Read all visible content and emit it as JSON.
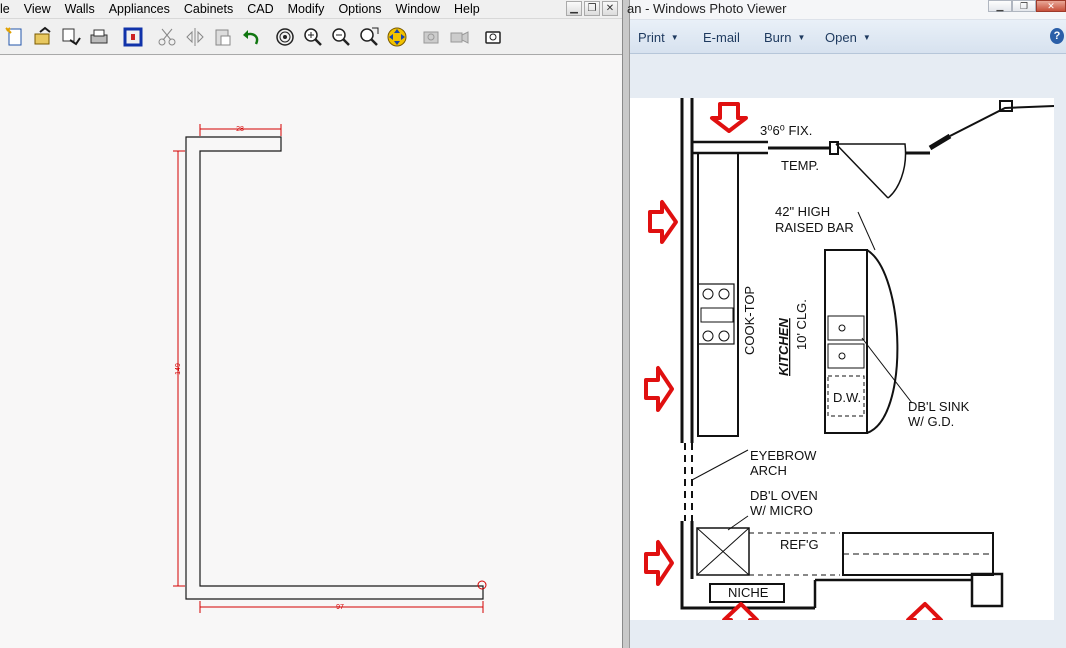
{
  "left_app": {
    "menu": [
      "le",
      "View",
      "Walls",
      "Appliances",
      "Cabinets",
      "CAD",
      "Modify",
      "Options",
      "Window",
      "Help"
    ],
    "mdi_buttons": [
      "minimize",
      "restore",
      "close"
    ],
    "toolbar_icons": [
      "new-plan",
      "open-plan",
      "save-plan",
      "print",
      "wall-select",
      "cut",
      "mirror",
      "paste",
      "undo",
      "zoom-center",
      "zoom-in",
      "zoom-out",
      "zoom-window",
      "pan",
      "camera-elevation",
      "camera-3d",
      "render-view"
    ],
    "dimensions": {
      "top": "28",
      "side": "149",
      "bottom": "97"
    },
    "colors": {
      "dimension": "#d40000",
      "wall": "#1a1a1a"
    }
  },
  "right_app": {
    "title": "an - Windows Photo Viewer",
    "commands": [
      {
        "label": "Print",
        "dropdown": true
      },
      {
        "label": "E-mail",
        "dropdown": false
      },
      {
        "label": "Burn",
        "dropdown": true
      },
      {
        "label": "Open",
        "dropdown": true
      }
    ],
    "help_glyph": "?",
    "plan_labels": {
      "fixed_window": "3⁰6⁰ FIX.",
      "temp": "TEMP.",
      "bar_line1": "42\" HIGH",
      "bar_line2": "RAISED BAR",
      "cooktop": "COOK-TOP",
      "kitchen": "KITCHEN",
      "ceiling": "10' CLG.",
      "dishwasher": "D.W.",
      "sink_line1": "DB'L SINK",
      "sink_line2": "W/  G.D.",
      "eyebrow_line1": "EYEBROW",
      "eyebrow_line2": "ARCH",
      "oven_line1": "DB'L OVEN",
      "oven_line2": "W/ MICRO",
      "refrigerator": "REF'G",
      "niche": "NICHE"
    },
    "arrow_color": "#e01010"
  }
}
